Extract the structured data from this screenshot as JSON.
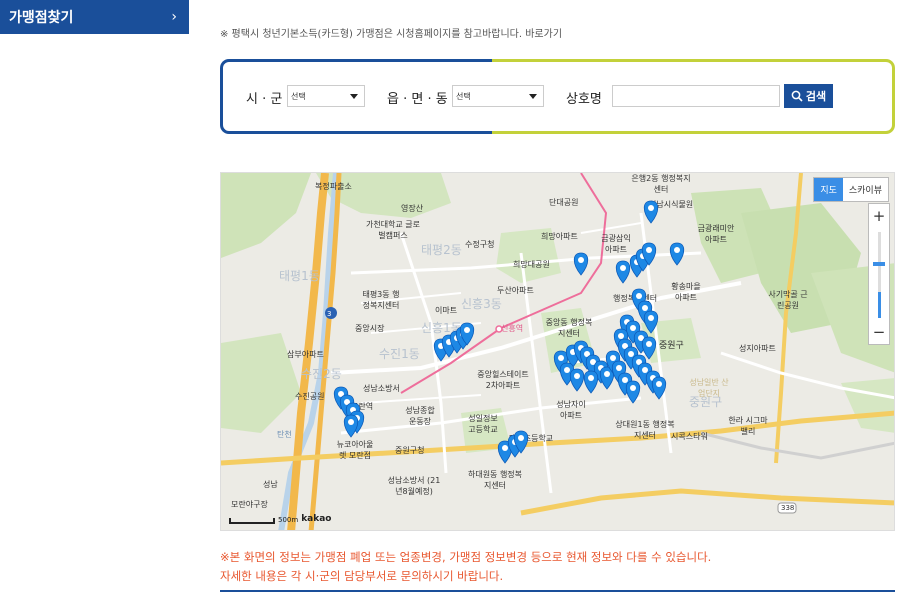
{
  "sidebar": {
    "title": "가맹점찾기",
    "chevron": "›"
  },
  "notice_top": "※ 평택시 청년기본소득(카드형) 가맹점은 시청홈페이지를 참고바랍니다. 바로가기",
  "search": {
    "city_label": "시 · 군",
    "city_value": "선택",
    "town_label": "읍 · 면 · 동",
    "town_value": "선택",
    "name_label": "상호명",
    "name_value": "",
    "button_label": "검색",
    "border_left": "#1a4f9a",
    "border_right": "#c3d13a"
  },
  "map": {
    "type_map": "지도",
    "type_sky": "스카이뷰",
    "zoom_in": "+",
    "zoom_out": "−",
    "scale_label": "500m",
    "brand": "kakao",
    "pin_color": "#1e88e5",
    "labels": {
      "l1": "복정파출소",
      "l2": "영장산",
      "l3": "가천대학교 글로벌캠퍼스",
      "l4": "수정구청",
      "l5": "단대공원",
      "l6": "희망아파트",
      "l7": "은행2동 행정복지센터",
      "l8": "금광삼익 아파트",
      "l9": "성남시식물원",
      "l10": "금광래미안 아파트",
      "l11": "태평3동 행정복지센터",
      "l12": "이마트",
      "l13": "두산아파트",
      "l14": "희망대공원",
      "l15": "행정복지센터",
      "l16": "황송마을 아파트",
      "l17": "사기막골 근린공원",
      "l18": "중앙시장",
      "l19": "신흥역",
      "l20": "중앙동 행정복지센터",
      "l21": "중원구",
      "l22": "성지아파트",
      "l23": "삼부아파트",
      "l24": "수진공원",
      "l25": "성남소방서",
      "l26": "중앙힐스테이트 2차아파트",
      "l27": "성남자이 아파트",
      "l28": "성남일반 산업단지",
      "l29": "모란역",
      "l30": "성남종합 운동장",
      "l31": "성일정보 고등학교",
      "l32": "대원초등학교",
      "l33": "상대원1동 행정복지센터",
      "l34": "시콕스타워",
      "l35": "한라 시그마밸리",
      "l36": "뉴코아아울렛 모란점",
      "l37": "중원구청",
      "l38": "탄천",
      "l39": "하대원동 행정복지센터",
      "l40": "성남소방서 (21년8월예정)",
      "l41": "성남",
      "l42": "모란야구장",
      "a1": "태평2동",
      "a2": "신흥3동",
      "a3": "신흥1동",
      "a4": "수진1동",
      "a5": "태평1동",
      "a6": "수진2동",
      "a7": "중원구",
      "r1": "3",
      "r2": "338"
    }
  },
  "note_red_1": "※본 화면의 정보는 가맹점 폐업 또는 업종변경, 가맹점 정보변경 등으로 현재 정보와 다를 수 있습니다.",
  "note_red_2": "자세한 내용은 각 시·군의 담당부서로 문의하시기 바랍니다."
}
